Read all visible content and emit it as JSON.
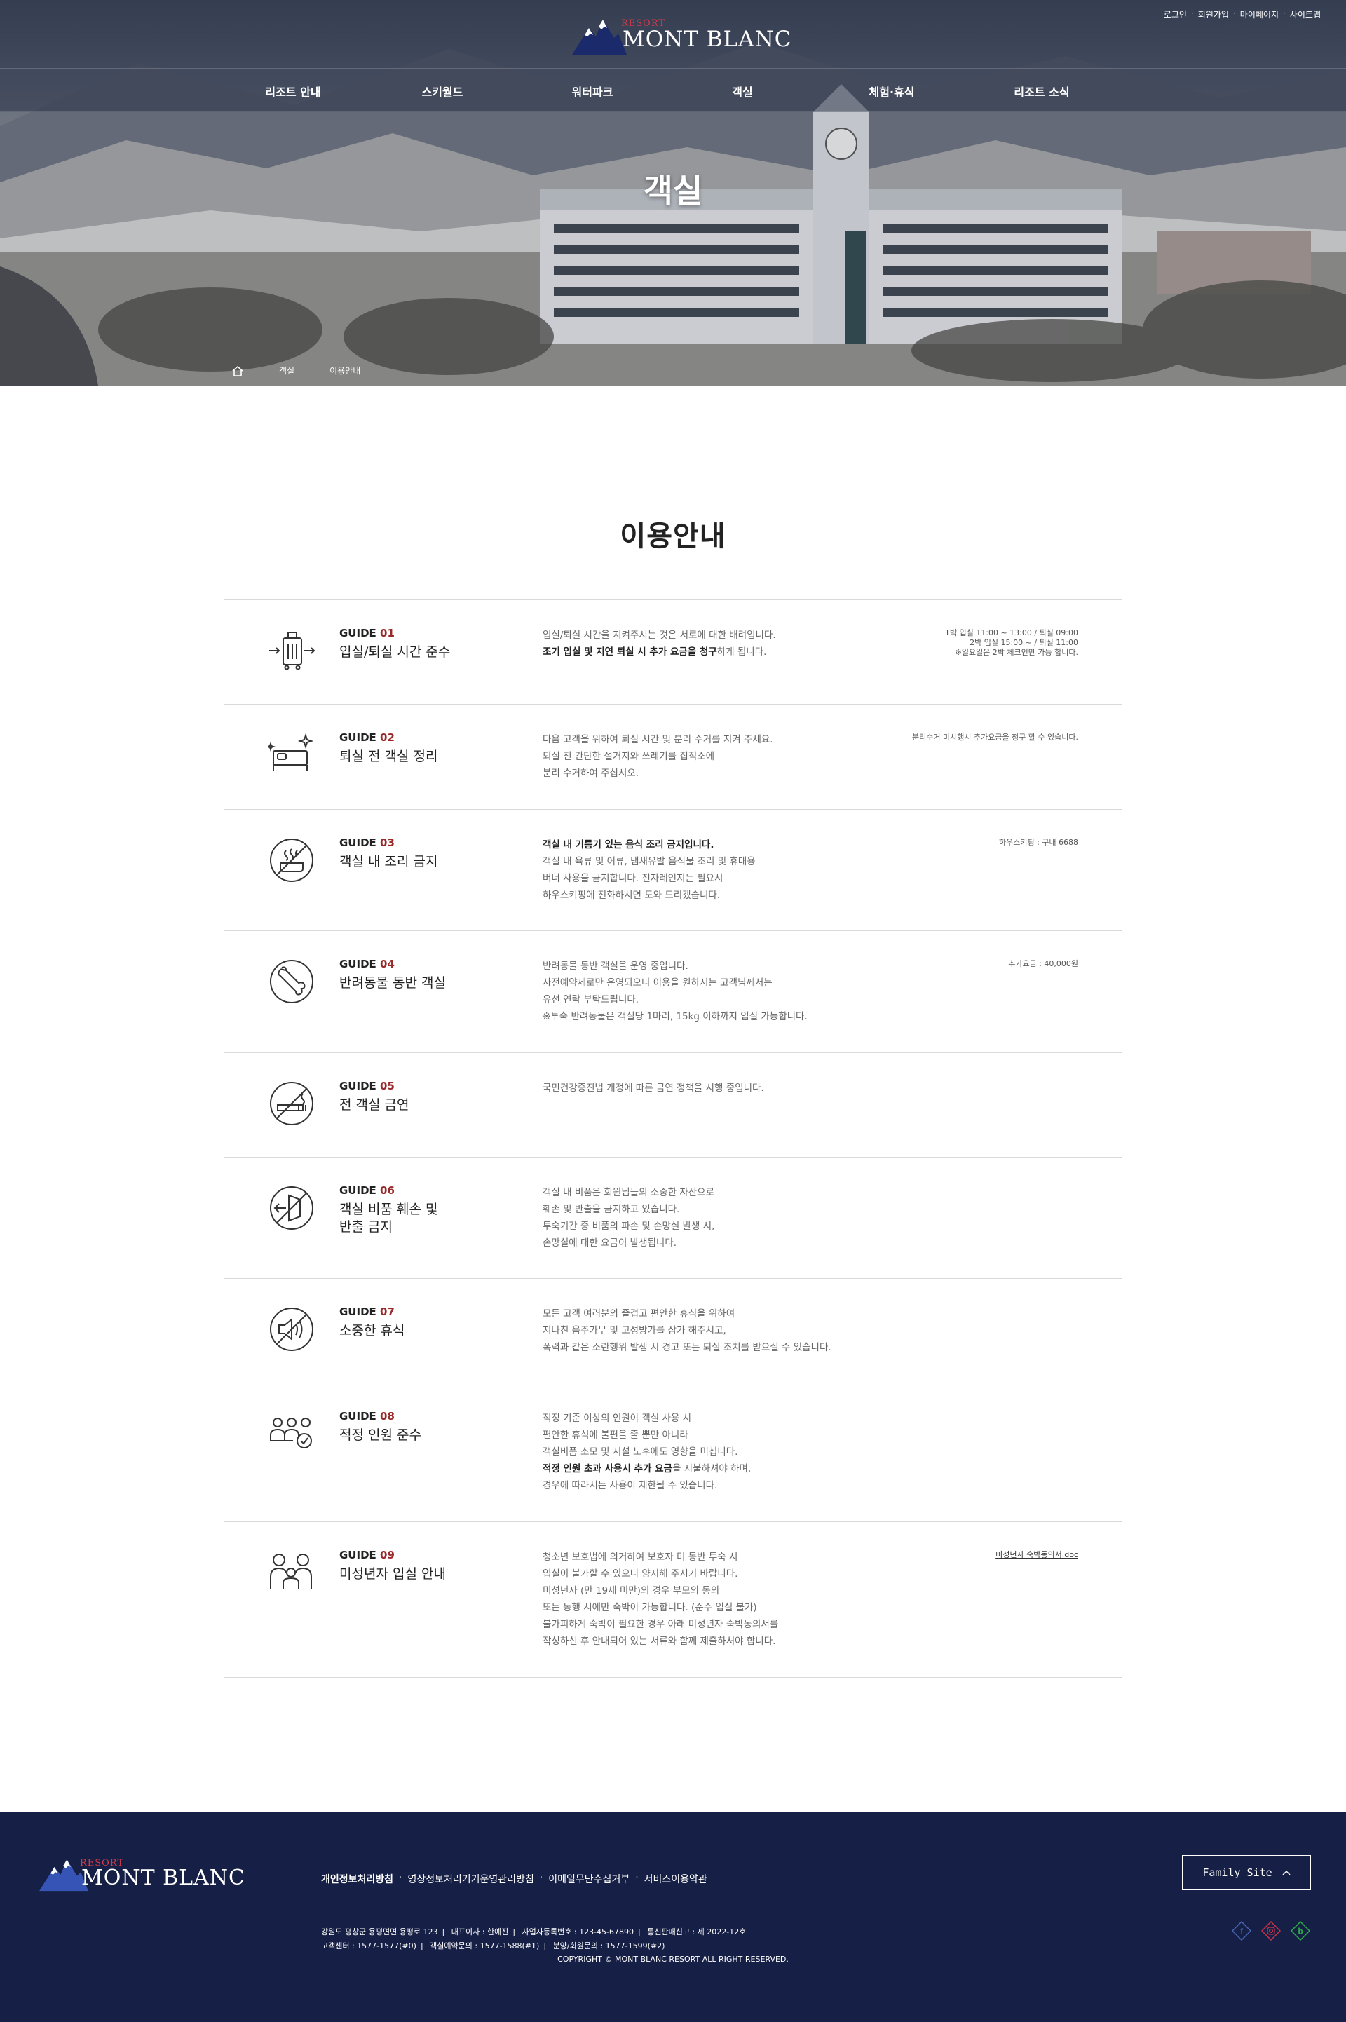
{
  "header": {
    "logo_small": "RESORT",
    "logo_text": "MONT BLANC",
    "util_links": [
      "로그인",
      "회원가입",
      "마이페이지",
      "사이트맵"
    ],
    "nav": [
      "리조트 안내",
      "스키월드",
      "워터파크",
      "객실",
      "체험·휴식",
      "리조트 소식"
    ],
    "hero_title": "객실",
    "breadcrumb": [
      "객실",
      "이용안내"
    ]
  },
  "main": {
    "title": "이용안내",
    "guides": [
      {
        "label": "GUIDE",
        "num": "01",
        "title": "입실/퇴실 시간 준수",
        "icon": "luggage-icon",
        "desc": [
          "입실/퇴실 시간을 지켜주시는 것은 서로에 대한 배려입니다."
        ],
        "desc_strong": "조기 입실 및 지연 퇴실 시 추가 요금을 청구",
        "desc_strong_tail": "하게 됩니다.",
        "note": [
          "1박 입실 11:00 ~ 13:00 / 퇴실 09:00",
          "2박 입실 15:00 ~ / 퇴실 11:00",
          "※일요일은 2박 체크인만 가능 합니다."
        ]
      },
      {
        "label": "GUIDE",
        "num": "02",
        "title": "퇴실 전 객실 정리",
        "icon": "clean-bed-icon",
        "desc": [
          "다음 고객을 위하여 퇴실 시간 및 분리 수거를 지켜 주세요.",
          "퇴실 전 간단한 설거지와 쓰레기를 집적소에",
          "분리 수거하여 주십시오."
        ],
        "note": [
          "분리수거 미시행시 추가요금을 청구 할 수 있습니다."
        ]
      },
      {
        "label": "GUIDE",
        "num": "03",
        "title": "객실 내 조리 금지",
        "icon": "no-cooking-icon",
        "desc_strong_first": "객실 내 기름기 있는 음식 조리 금지입니다.",
        "desc": [
          "객실 내 육류 및 어류, 냄새유발 음식물 조리 및 휴대용",
          "버너 사용을 금지합니다. 전자레인지는 필요시",
          "하우스키핑에 전화하시면 도와 드리겠습니다."
        ],
        "note": [
          "하우스키핑 : 구내 6688"
        ]
      },
      {
        "label": "GUIDE",
        "num": "04",
        "title": "반려동물 동반 객실",
        "icon": "bone-icon",
        "desc": [
          "반려동물 동반 객실을 운영 중입니다.",
          "사전예약제로만 운영되오니 이용을 원하시는 고객님께서는",
          "유선 연락 부탁드립니다.",
          "※투숙 반려동물은 객실당 1마리, 15kg 이하까지 입실 가능합니다."
        ],
        "note": [
          "추가요금 : 40,000원"
        ]
      },
      {
        "label": "GUIDE",
        "num": "05",
        "title": "전 객실 금연",
        "icon": "no-smoking-icon",
        "desc": [
          "국민건강증진법 개정에 따른 금연 정책을 시행 중입니다."
        ],
        "note": []
      },
      {
        "label": "GUIDE",
        "num": "06",
        "title": "객실 비품 훼손 및 반출 금지",
        "title_lines": [
          "객실 비품 훼손 및",
          "반출 금지"
        ],
        "icon": "no-removal-icon",
        "desc": [
          "객실 내 비품은 회원님들의 소중한 자산으로",
          "훼손 및 반출을 금지하고 있습니다.",
          "투숙기간 중 비품의 파손 및 손망실 발생 시,",
          "손망실에 대한 요금이 발생됩니다."
        ],
        "note": []
      },
      {
        "label": "GUIDE",
        "num": "07",
        "title": "소중한 휴식",
        "icon": "no-noise-icon",
        "desc": [
          "모든 고객 여러분의 즐겁고 편안한 휴식을 위하여",
          "지나친 음주가무 및 고성방가를 삼가 해주시고,",
          "폭력과 같은 소란행위 발생 시 경고 또는 퇴실 조치를 받으실 수 있습니다."
        ],
        "note": []
      },
      {
        "label": "GUIDE",
        "num": "08",
        "title": "적정 인원 준수",
        "icon": "group-check-icon",
        "desc": [
          "적정 기준 이상의 인원이 객실 사용 시",
          "편안한 휴식에 불편을 줄 뿐만 아니라",
          "객실비품 소모 및 시설 노후에도 영향을 미칩니다."
        ],
        "desc_strong": "적정 인원 초과 사용시 추가 요금",
        "desc_strong_tail": "을 지불하셔야 하며,",
        "desc_after": [
          "경우에 따라서는 사용이 제한될 수 있습니다."
        ],
        "note": []
      },
      {
        "label": "GUIDE",
        "num": "09",
        "title": "미성년자 입실 안내",
        "icon": "family-icon",
        "desc": [
          "청소년 보호법에 의거하여 보호자 미 동반 투숙 시",
          "입실이 불가할 수 있으니 양지해 주시기 바랍니다.",
          "미성년자 (만 19세 미만)의 경우 부모의 동의",
          "또는 동행 시에만 숙박이 가능합니다. (준수 입실 불가)",
          "불가피하게 숙박이 필요한 경우 아래 미성년자 숙박동의서를",
          "작성하신 후 안내되어 있는 서류와 함께 제출하셔야 합니다."
        ],
        "note": [
          "미성년자 숙박동의서.doc"
        ]
      }
    ]
  },
  "footer": {
    "logo_small": "RESORT",
    "logo_text": "MONT BLANC",
    "policies": [
      "개인정보처리방침",
      "영상정보처리기기운영관리방침",
      "이메일무단수집거부",
      "서비스이용약관"
    ],
    "family_site": "Family Site",
    "info_row1": [
      "강원도 평창군 용평면면 용평로 123",
      "대표이사 : 한예진",
      "사업자등록번호 : 123-45-67890",
      "통신판매신고 : 제 2022-12호"
    ],
    "info_row2": [
      "고객센터 : 1577-1577(#0)",
      "객실예약문의 : 1577-1588(#1)",
      "분양/회원문의 : 1577-1599(#2)"
    ],
    "copyright": "COPYRIGHT © MONT BLANC RESORT ALL RIGHT RESERVED.",
    "sns": [
      {
        "icon": "facebook-icon",
        "glyph": "f",
        "color": "#4a67b5"
      },
      {
        "icon": "instagram-icon",
        "glyph": "◎",
        "color": "#c8344a"
      },
      {
        "icon": "blog-icon",
        "glyph": "b",
        "color": "#2db04a"
      }
    ]
  }
}
